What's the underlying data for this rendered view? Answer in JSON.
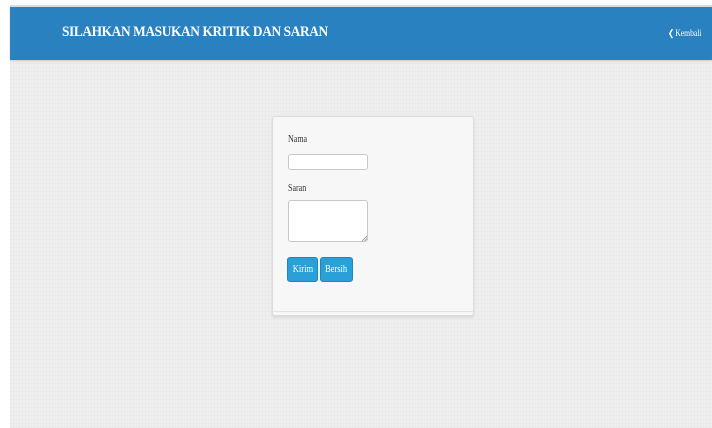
{
  "header": {
    "title": "SILAHKAN MASUKAN KRITIK DAN SARAN",
    "back_label": "Kembali",
    "back_icon": "chevron-left-icon"
  },
  "form": {
    "name_label": "Nama",
    "name_value": "",
    "suggestion_label": "Saran",
    "suggestion_value": "",
    "submit_label": "Kirim",
    "clear_label": "Bersih"
  },
  "colors": {
    "navbar": "#2a81bf",
    "button": "#2a9fd8",
    "background": "#eeeeee"
  }
}
